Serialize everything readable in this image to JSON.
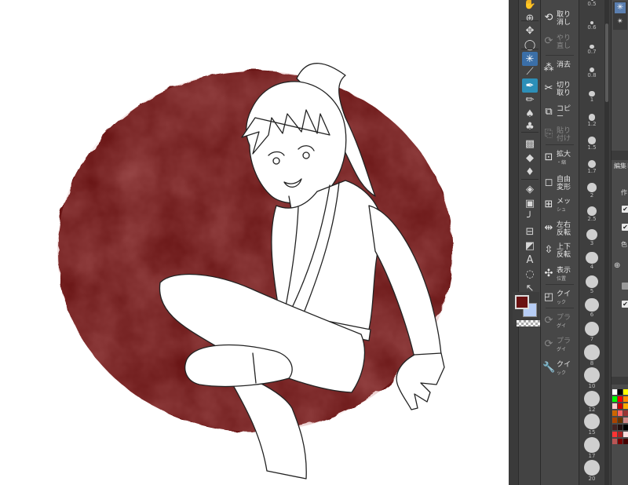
{
  "canvas": {
    "circle_color": "#6b1212",
    "circle_highlight": "#8a2a2a"
  },
  "tools": [
    {
      "icon": "hand-icon",
      "glyph": "✋"
    },
    {
      "icon": "zoom-icon",
      "glyph": "⊕"
    },
    {
      "icon": "move-icon",
      "glyph": "✥"
    },
    {
      "icon": "lasso-icon",
      "glyph": "◯"
    },
    {
      "icon": "magic-wand-icon",
      "glyph": "✳"
    },
    {
      "icon": "eyedropper-icon",
      "glyph": "⟋"
    },
    {
      "icon": "pen-icon",
      "glyph": "✒"
    },
    {
      "icon": "pencil-icon",
      "glyph": "✏"
    },
    {
      "icon": "brush-icon",
      "glyph": "♠"
    },
    {
      "icon": "airbrush-icon",
      "glyph": "♣"
    },
    {
      "icon": "decoration-icon",
      "glyph": "▩"
    },
    {
      "icon": "eraser-icon",
      "glyph": "◆"
    },
    {
      "icon": "blend-icon",
      "glyph": "♦"
    },
    {
      "icon": "fill-icon",
      "glyph": "◈"
    },
    {
      "icon": "gradient-icon",
      "glyph": "▣"
    },
    {
      "icon": "figure-icon",
      "glyph": "╯"
    },
    {
      "icon": "frame-icon",
      "glyph": "⊟"
    },
    {
      "icon": "ruler-icon",
      "glyph": "◩"
    },
    {
      "icon": "text-icon",
      "glyph": "A"
    },
    {
      "icon": "balloon-icon",
      "glyph": "◌"
    },
    {
      "icon": "correct-line-icon",
      "glyph": "↖"
    }
  ],
  "colors": {
    "foreground": "#6b1212",
    "background": "#b7cdf5"
  },
  "commands": [
    {
      "icon": "undo-icon",
      "glyph": "⟲",
      "label": "取り\n消し",
      "enabled": true
    },
    {
      "icon": "redo-icon",
      "glyph": "⟳",
      "label": "やり\n直し",
      "enabled": false
    },
    {
      "icon": "clear-icon",
      "glyph": "⁂",
      "label": "消去",
      "enabled": true
    },
    {
      "icon": "cut-icon",
      "glyph": "✂",
      "label": "切り\n取り",
      "enabled": true
    },
    {
      "icon": "copy-icon",
      "glyph": "⧉",
      "label": "コピ\nー",
      "enabled": true
    },
    {
      "icon": "paste-icon",
      "glyph": "⎘",
      "label": "貼り\n付け",
      "enabled": false
    },
    {
      "icon": "scale-icon",
      "glyph": "⊡",
      "label": "拡大",
      "sub": "・縮",
      "enabled": true
    },
    {
      "icon": "free-transform-icon",
      "glyph": "◻",
      "label": "自由\n変形",
      "enabled": true
    },
    {
      "icon": "mesh-icon",
      "glyph": "⊞",
      "label": "メッ",
      "sub": "シュ",
      "enabled": true
    },
    {
      "icon": "flip-h-icon",
      "glyph": "⇹",
      "label": "左右\n反転",
      "enabled": true
    },
    {
      "icon": "flip-v-icon",
      "glyph": "⇳",
      "label": "上下\n反転",
      "enabled": true
    },
    {
      "icon": "show-icon",
      "glyph": "✣",
      "label": "表示",
      "sub": "位置",
      "enabled": true
    },
    {
      "icon": "quick-mask-icon",
      "glyph": "◰",
      "label": "クイ",
      "sub": "ック",
      "enabled": true
    },
    {
      "icon": "plugin-1-icon",
      "glyph": "⟳",
      "label": "プラ",
      "sub": "グイ",
      "enabled": false
    },
    {
      "icon": "plugin-2-icon",
      "glyph": "⟳",
      "label": "プラ",
      "sub": "グイ",
      "enabled": false
    },
    {
      "icon": "quick-access-icon",
      "glyph": "🔧",
      "label": "クイ",
      "sub": "ック",
      "enabled": true
    }
  ],
  "brush_sizes": [
    {
      "label": "0.5"
    },
    {
      "label": "0.6"
    },
    {
      "label": "0.7"
    },
    {
      "label": "0.8"
    },
    {
      "label": "1"
    },
    {
      "label": "1.2"
    },
    {
      "label": "1.5"
    },
    {
      "label": "1.7"
    },
    {
      "label": "2"
    },
    {
      "label": "2.5"
    },
    {
      "label": "3"
    },
    {
      "label": "4"
    },
    {
      "label": "5"
    },
    {
      "label": "6"
    },
    {
      "label": "7"
    },
    {
      "label": "8"
    },
    {
      "label": "10"
    },
    {
      "label": "12"
    },
    {
      "label": "15"
    },
    {
      "label": "17"
    },
    {
      "label": "20"
    }
  ],
  "right_panel": {
    "header_tab": "編集レ",
    "label_1": "作",
    "label_2": "色",
    "checked": [
      "✔",
      "✔",
      "✔",
      "✔"
    ]
  }
}
